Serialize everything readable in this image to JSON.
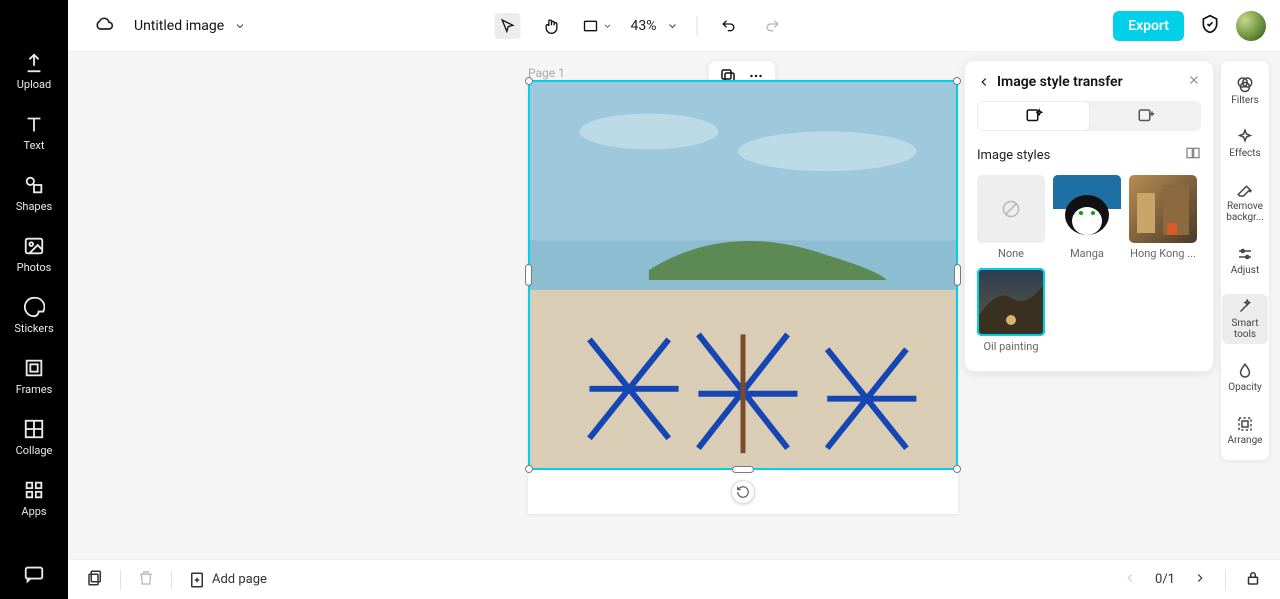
{
  "document": {
    "title": "Untitled image"
  },
  "toolbar": {
    "zoom": "43%",
    "export_label": "Export"
  },
  "left_rail": {
    "items": [
      {
        "label": "Upload",
        "icon": "upload"
      },
      {
        "label": "Text",
        "icon": "text"
      },
      {
        "label": "Shapes",
        "icon": "shapes"
      },
      {
        "label": "Photos",
        "icon": "photos"
      },
      {
        "label": "Stickers",
        "icon": "stickers"
      },
      {
        "label": "Frames",
        "icon": "frames"
      },
      {
        "label": "Collage",
        "icon": "collage"
      },
      {
        "label": "Apps",
        "icon": "apps"
      }
    ]
  },
  "canvas": {
    "page_label": "Page 1"
  },
  "right_rail": {
    "items": [
      {
        "label": "Filters"
      },
      {
        "label": "Effects"
      },
      {
        "label": "Remove backgr..."
      },
      {
        "label": "Adjust"
      },
      {
        "label": "Smart tools",
        "selected": true
      },
      {
        "label": "Opacity"
      },
      {
        "label": "Arrange"
      }
    ]
  },
  "panel": {
    "title": "Image style transfer",
    "section": "Image styles",
    "styles": [
      {
        "label": "None"
      },
      {
        "label": "Manga"
      },
      {
        "label": "Hong Kong ..."
      },
      {
        "label": "Oil painting",
        "selected": true
      }
    ]
  },
  "bottom": {
    "add_page_label": "Add page",
    "page_indicator": "0/1"
  },
  "colors": {
    "accent": "#00d1e8"
  }
}
